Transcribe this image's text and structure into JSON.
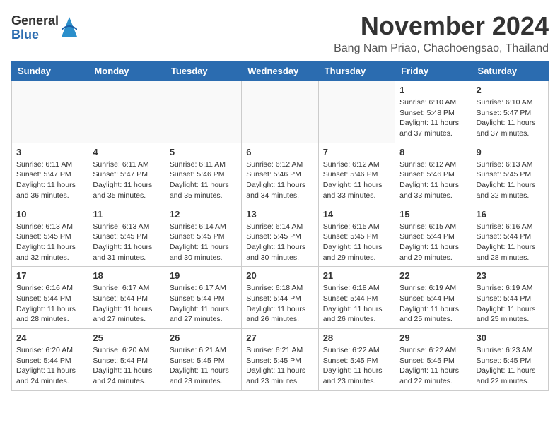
{
  "header": {
    "logo": {
      "general": "General",
      "blue": "Blue",
      "icon": "▶"
    },
    "month": "November 2024",
    "location": "Bang Nam Priao, Chachoengsao, Thailand"
  },
  "days_of_week": [
    "Sunday",
    "Monday",
    "Tuesday",
    "Wednesday",
    "Thursday",
    "Friday",
    "Saturday"
  ],
  "weeks": [
    [
      {
        "day": "",
        "info": ""
      },
      {
        "day": "",
        "info": ""
      },
      {
        "day": "",
        "info": ""
      },
      {
        "day": "",
        "info": ""
      },
      {
        "day": "",
        "info": ""
      },
      {
        "day": "1",
        "info": "Sunrise: 6:10 AM\nSunset: 5:48 PM\nDaylight: 11 hours\nand 37 minutes."
      },
      {
        "day": "2",
        "info": "Sunrise: 6:10 AM\nSunset: 5:47 PM\nDaylight: 11 hours\nand 37 minutes."
      }
    ],
    [
      {
        "day": "3",
        "info": "Sunrise: 6:11 AM\nSunset: 5:47 PM\nDaylight: 11 hours\nand 36 minutes."
      },
      {
        "day": "4",
        "info": "Sunrise: 6:11 AM\nSunset: 5:47 PM\nDaylight: 11 hours\nand 35 minutes."
      },
      {
        "day": "5",
        "info": "Sunrise: 6:11 AM\nSunset: 5:46 PM\nDaylight: 11 hours\nand 35 minutes."
      },
      {
        "day": "6",
        "info": "Sunrise: 6:12 AM\nSunset: 5:46 PM\nDaylight: 11 hours\nand 34 minutes."
      },
      {
        "day": "7",
        "info": "Sunrise: 6:12 AM\nSunset: 5:46 PM\nDaylight: 11 hours\nand 33 minutes."
      },
      {
        "day": "8",
        "info": "Sunrise: 6:12 AM\nSunset: 5:46 PM\nDaylight: 11 hours\nand 33 minutes."
      },
      {
        "day": "9",
        "info": "Sunrise: 6:13 AM\nSunset: 5:45 PM\nDaylight: 11 hours\nand 32 minutes."
      }
    ],
    [
      {
        "day": "10",
        "info": "Sunrise: 6:13 AM\nSunset: 5:45 PM\nDaylight: 11 hours\nand 32 minutes."
      },
      {
        "day": "11",
        "info": "Sunrise: 6:13 AM\nSunset: 5:45 PM\nDaylight: 11 hours\nand 31 minutes."
      },
      {
        "day": "12",
        "info": "Sunrise: 6:14 AM\nSunset: 5:45 PM\nDaylight: 11 hours\nand 30 minutes."
      },
      {
        "day": "13",
        "info": "Sunrise: 6:14 AM\nSunset: 5:45 PM\nDaylight: 11 hours\nand 30 minutes."
      },
      {
        "day": "14",
        "info": "Sunrise: 6:15 AM\nSunset: 5:45 PM\nDaylight: 11 hours\nand 29 minutes."
      },
      {
        "day": "15",
        "info": "Sunrise: 6:15 AM\nSunset: 5:44 PM\nDaylight: 11 hours\nand 29 minutes."
      },
      {
        "day": "16",
        "info": "Sunrise: 6:16 AM\nSunset: 5:44 PM\nDaylight: 11 hours\nand 28 minutes."
      }
    ],
    [
      {
        "day": "17",
        "info": "Sunrise: 6:16 AM\nSunset: 5:44 PM\nDaylight: 11 hours\nand 28 minutes."
      },
      {
        "day": "18",
        "info": "Sunrise: 6:17 AM\nSunset: 5:44 PM\nDaylight: 11 hours\nand 27 minutes."
      },
      {
        "day": "19",
        "info": "Sunrise: 6:17 AM\nSunset: 5:44 PM\nDaylight: 11 hours\nand 27 minutes."
      },
      {
        "day": "20",
        "info": "Sunrise: 6:18 AM\nSunset: 5:44 PM\nDaylight: 11 hours\nand 26 minutes."
      },
      {
        "day": "21",
        "info": "Sunrise: 6:18 AM\nSunset: 5:44 PM\nDaylight: 11 hours\nand 26 minutes."
      },
      {
        "day": "22",
        "info": "Sunrise: 6:19 AM\nSunset: 5:44 PM\nDaylight: 11 hours\nand 25 minutes."
      },
      {
        "day": "23",
        "info": "Sunrise: 6:19 AM\nSunset: 5:44 PM\nDaylight: 11 hours\nand 25 minutes."
      }
    ],
    [
      {
        "day": "24",
        "info": "Sunrise: 6:20 AM\nSunset: 5:44 PM\nDaylight: 11 hours\nand 24 minutes."
      },
      {
        "day": "25",
        "info": "Sunrise: 6:20 AM\nSunset: 5:44 PM\nDaylight: 11 hours\nand 24 minutes."
      },
      {
        "day": "26",
        "info": "Sunrise: 6:21 AM\nSunset: 5:45 PM\nDaylight: 11 hours\nand 23 minutes."
      },
      {
        "day": "27",
        "info": "Sunrise: 6:21 AM\nSunset: 5:45 PM\nDaylight: 11 hours\nand 23 minutes."
      },
      {
        "day": "28",
        "info": "Sunrise: 6:22 AM\nSunset: 5:45 PM\nDaylight: 11 hours\nand 23 minutes."
      },
      {
        "day": "29",
        "info": "Sunrise: 6:22 AM\nSunset: 5:45 PM\nDaylight: 11 hours\nand 22 minutes."
      },
      {
        "day": "30",
        "info": "Sunrise: 6:23 AM\nSunset: 5:45 PM\nDaylight: 11 hours\nand 22 minutes."
      }
    ]
  ]
}
